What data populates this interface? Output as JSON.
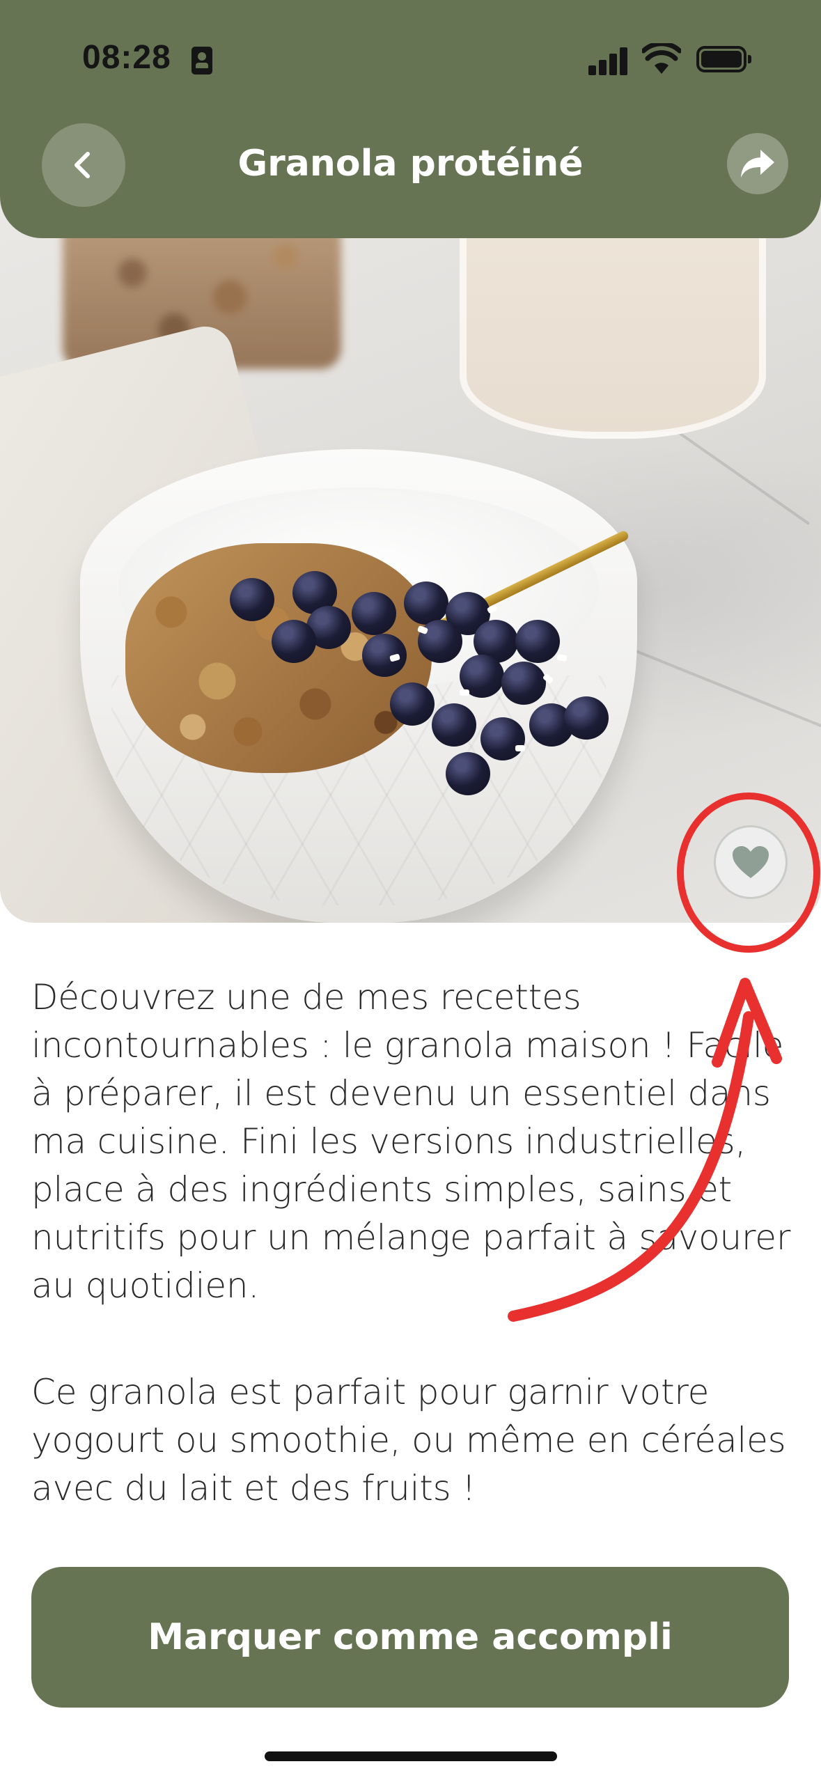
{
  "status_bar": {
    "time": "08:28"
  },
  "header": {
    "title": "Granola protéiné"
  },
  "description": {
    "paragraphs": [
      "Découvrez une de mes recettes incontournables : le granola maison ! Facile à préparer, il est devenu un essentiel dans ma cuisine. Fini les versions industrielles, place à des ingrédients simples, sains et nutritifs pour un mélange parfait à savourer au quotidien.",
      "Ce granola est parfait pour garnir votre yogourt ou smoothie, ou même en céréales avec du lait et des fruits !"
    ]
  },
  "cta": {
    "label": "Marquer comme accompli"
  },
  "colors": {
    "accent": "#677454",
    "annotation": "#e8302f",
    "favorite_icon": "#8f9f96"
  },
  "icons": {
    "back": "chevron-left-icon",
    "share": "share-arrow-icon",
    "favorite": "heart-icon"
  }
}
